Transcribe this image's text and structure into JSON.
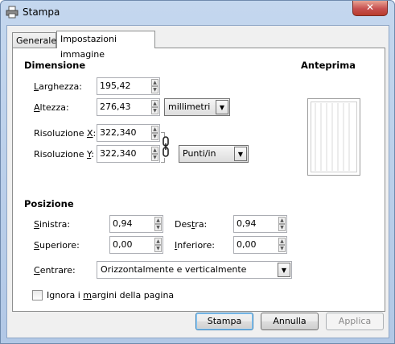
{
  "window": {
    "title": "Stampa",
    "close_glyph": "✕"
  },
  "tabs": [
    {
      "label": "Generale"
    },
    {
      "label": "Impostazioni immagine"
    }
  ],
  "dimension": {
    "header": "Dimensione",
    "width_label_u": "L",
    "width_label_rest": "arghezza:",
    "width_value": "195,42",
    "height_label_u": "A",
    "height_label_rest": "ltezza:",
    "height_value": "276,43",
    "unit": "millimetri",
    "resx_label_pre": "Risoluzione ",
    "resx_label_u": "X",
    "resx_label_post": ":",
    "resx_value": "322,340",
    "resy_label_pre": "Risoluzione ",
    "resy_label_u": "Y",
    "resy_label_post": ":",
    "resy_value": "322,340",
    "res_unit": "Punti/in"
  },
  "preview": {
    "header": "Anteprima"
  },
  "position": {
    "header": "Posizione",
    "left_label_u": "S",
    "left_label_rest": "inistra:",
    "left_value": "0,94",
    "right_label_pre": "Des",
    "right_label_u": "t",
    "right_label_post": "ra:",
    "right_value": "0,94",
    "top_label_u": "S",
    "top_label_rest": "uperiore:",
    "top_value": "0,00",
    "bottom_label_u": "I",
    "bottom_label_rest": "nferiore:",
    "bottom_value": "0,00",
    "center_label_u": "C",
    "center_label_rest": "entrare:",
    "center_value": "Orizzontalmente e verticalmente"
  },
  "ignore_margins": {
    "pre": "Ignora i ",
    "u": "m",
    "post": "argini della pagina",
    "checked": false
  },
  "buttons": {
    "print": "Stampa",
    "cancel": "Annulla",
    "apply": "Applica"
  }
}
